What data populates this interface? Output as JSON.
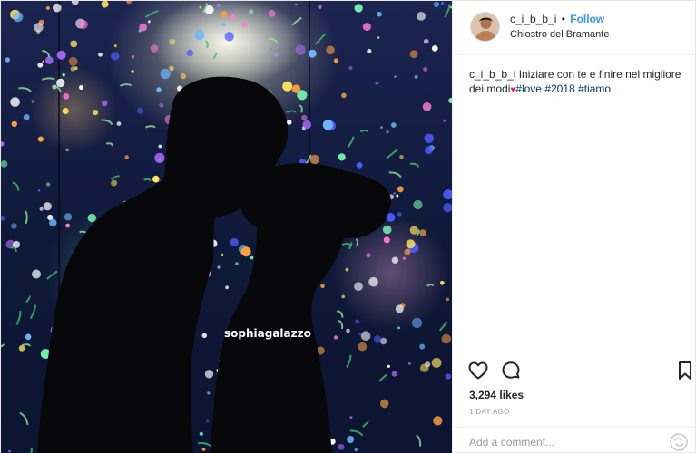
{
  "post": {
    "photo": {
      "watermark": "sophiagalazzo",
      "icon": "couple-silhouette-photo"
    },
    "header": {
      "username": "c_i_b_b_i",
      "separator": "•",
      "follow_label": "Follow",
      "location": "Chiostro del Bramante",
      "avatar_icon": "user-avatar"
    },
    "caption": {
      "username": "c_i_b_b_i",
      "text": "Iniziare con te e finire nel migliore dei modi",
      "heart": "♥",
      "hashtags": [
        "#love",
        "#2018",
        "#tiamo"
      ]
    },
    "actions": {
      "like_icon": "heart-outline-icon",
      "comment_icon": "comment-bubble-icon",
      "save_icon": "bookmark-icon",
      "likes": "3,294 likes",
      "timestamp": "1 DAY AGO"
    },
    "comment": {
      "placeholder": "Add a comment...",
      "options_icon": "more-options-icon"
    }
  },
  "colors": {
    "link": "#3897f0",
    "hashtag": "#003569",
    "muted": "#999999",
    "heart": "#e0245e",
    "border": "#efefef"
  }
}
